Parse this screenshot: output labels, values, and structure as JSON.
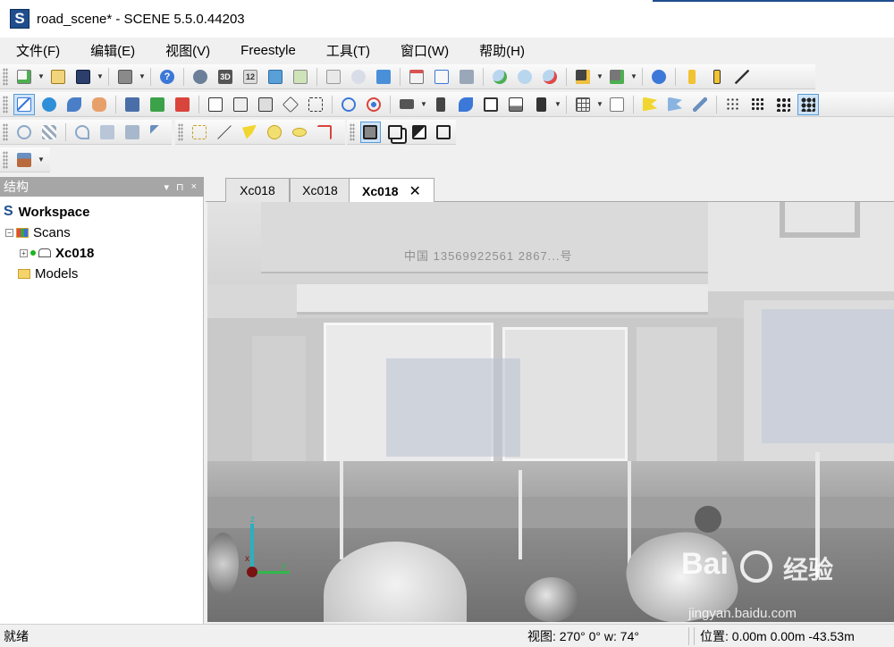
{
  "window": {
    "title": "road_scene* - SCENE 5.5.0.44203",
    "logo_letter": "S"
  },
  "menu": [
    "文件(F)",
    "编辑(E)",
    "视图(V)",
    "Freestyle",
    "工具(T)",
    "窗口(W)",
    "帮助(H)"
  ],
  "toolbar": {
    "icons_row1": [
      "new-file-icon",
      "open-icon",
      "save-icon",
      "print-icon",
      "help-icon",
      "scan-icon",
      "3d-view-icon",
      "2d-view-icon",
      "home-view-icon",
      "image-view-icon",
      "copy-icon",
      "clipboard-icon",
      "download-icon",
      "calendar-icon",
      "report-icon",
      "print-preview-icon",
      "cloud-add-icon",
      "cloud-icon",
      "cloud-remove-icon",
      "camera-plus-icon",
      "camera-minus-icon",
      "network-icon",
      "ruler-icon",
      "measure-icon",
      "distance-icon"
    ],
    "icons_row2": [
      "select-icon",
      "globe-icon",
      "leaf-icon",
      "eraser-icon",
      "up-icon",
      "up-green-icon",
      "down-red-icon",
      "cube-front-icon",
      "cube-side-icon",
      "cube-top-icon",
      "cube-iso-icon",
      "cube-wire-icon",
      "zoom-icon",
      "target-icon",
      "camera-icon",
      "move-icon",
      "rotate-icon",
      "screen-icon",
      "picture-icon",
      "bin-icon",
      "grid-icon",
      "page-icon",
      "flag-icon",
      "flag-blue-icon",
      "wand-icon",
      "dots-small-icon",
      "dots-medium-icon",
      "dots-large-icon",
      "dots-xlarge-icon"
    ],
    "label_3d": "3D",
    "label_12": "12"
  },
  "left_pane": {
    "title": "结构",
    "pin_glyph": "▾",
    "dock_glyph": "⊓",
    "close_glyph": "×",
    "tree": {
      "workspace": "Workspace",
      "scans": "Scans",
      "scan_item": "Xc018",
      "models": "Models"
    }
  },
  "tabs": [
    {
      "label": "Xc018",
      "active": false
    },
    {
      "label": "Xc018",
      "active": false
    },
    {
      "label": "Xc018",
      "active": true
    }
  ],
  "tab_close_glyph": "✕",
  "viewport": {
    "sign_text": "中国 13569922561 2867...号",
    "axis_x": "x",
    "axis_y": "y",
    "axis_z": "z",
    "watermark": "Bai",
    "watermark2": "经验",
    "watermark_url": "jingyan.baidu.com"
  },
  "statusbar": {
    "ready": "就绪",
    "view": "视图:  270° 0° w:   74°",
    "position": "位置:   0.00m 0.00m -43.53m"
  }
}
